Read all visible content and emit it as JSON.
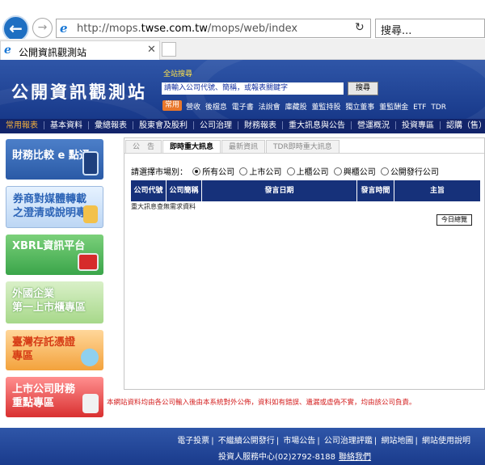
{
  "browser": {
    "url_prefix": "http://mops.",
    "url_domain": "twse.com.tw",
    "url_suffix": "/mops/web/index",
    "search_placeholder": "搜尋...",
    "tab_title": "公開資訊觀測站",
    "refresh_glyph": "↻",
    "close_glyph": "✕"
  },
  "header": {
    "logo": "公開資訊觀測站",
    "search_label": "全站搜尋",
    "search_value": "請輸入公司代號、簡稱，或報表關鍵字",
    "search_button": "搜尋",
    "common_tag": "常用",
    "common_links": [
      "營收",
      "後檔息",
      "電子書",
      "法說會",
      "庫藏股",
      "董監持股",
      "獨立董事",
      "董監酬金",
      "ETF",
      "TDR"
    ]
  },
  "mainnav": [
    "常用報表",
    "基本資料",
    "彙總報表",
    "股東會及股利",
    "公司治理",
    "財務報表",
    "重大訊息與公告",
    "營運概況",
    "投資專區",
    "認購（售）權"
  ],
  "banners": {
    "b1": "財務比較 e 點通",
    "b2a": "券商對媒體轉載",
    "b2b": "之澄清或說明專區",
    "b3": "XBRL資訊平台",
    "b4a": "外國企業",
    "b4b": "第一上市櫃專區",
    "b5a": "臺灣存託憑證",
    "b5b": "專區",
    "b6a": "上市公司財務",
    "b6b": "重點專區"
  },
  "tabs": [
    "公　告",
    "即時重大訊息",
    "最新資訊",
    "TDR即時重大訊息"
  ],
  "market": {
    "prompt": "請選擇市場別：",
    "options": [
      "所有公司",
      "上市公司",
      "上櫃公司",
      "興櫃公司",
      "公開發行公司"
    ],
    "selected": "所有公司"
  },
  "table": {
    "headers": [
      "公司代號",
      "公司簡稱",
      "發言日期",
      "發言時間",
      "主旨"
    ],
    "empty_message": "重大訊息查無需求資料",
    "today_button": "今日總覽"
  },
  "disclaimer": "本網站資料均由各公司輸入後由本系統對外公佈，資料如有錯誤、遺漏或虛偽不實，均由該公司負責。",
  "footer": {
    "links": [
      "電子投票",
      "不繼續公開發行",
      "市場公告",
      "公司治理評鑑",
      "網站地圖",
      "網站使用說明"
    ],
    "contact": "投資人服務中心(02)2792-8188",
    "contact_link": "聯絡我們"
  }
}
